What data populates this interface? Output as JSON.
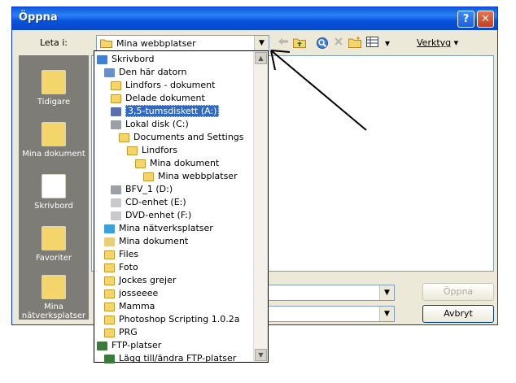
{
  "window": {
    "title": "Öppna",
    "help_label": "?",
    "close_label": "✕"
  },
  "lookin": {
    "label": "Leta i:",
    "value": "Mina webbplatser"
  },
  "toolbar": {
    "tools_label": "Verktyg"
  },
  "places": [
    {
      "label": "Tidigare",
      "icon": "recent-icon"
    },
    {
      "label": "Mina dokument",
      "icon": "my-documents-icon"
    },
    {
      "label": "Skrivbord",
      "icon": "desktop-icon"
    },
    {
      "label": "Favoriter",
      "icon": "favorites-icon"
    },
    {
      "label": "Mina nätverksplatser",
      "icon": "network-places-icon"
    }
  ],
  "buttons": {
    "open_label": "Öppna",
    "cancel_label": "Avbryt"
  },
  "dropdown": {
    "items": [
      {
        "label": "Skrivbord",
        "icon": "desktop-icon"
      },
      {
        "label": "Den här datorn",
        "icon": "computer-icon"
      },
      {
        "label": "Lindfors - dokument",
        "icon": "folder-icon"
      },
      {
        "label": "Delade dokument",
        "icon": "folder-icon"
      },
      {
        "label": "3,5-tumsdiskett (A:)",
        "icon": "floppy-icon",
        "selected": true
      },
      {
        "label": "Lokal disk (C:)",
        "icon": "drive-icon"
      },
      {
        "label": "Documents and Settings",
        "icon": "folder-icon"
      },
      {
        "label": "Lindfors",
        "icon": "folder-icon"
      },
      {
        "label": "Mina dokument",
        "icon": "folder-icon"
      },
      {
        "label": "Mina webbplatser",
        "icon": "folder-icon"
      },
      {
        "label": "BFV_1 (D:)",
        "icon": "drive-icon"
      },
      {
        "label": "CD-enhet (E:)",
        "icon": "cd-icon"
      },
      {
        "label": "DVD-enhet (F:)",
        "icon": "dvd-icon"
      },
      {
        "label": "Mina nätverksplatser",
        "icon": "network-icon"
      },
      {
        "label": "Mina dokument",
        "icon": "documents-icon"
      },
      {
        "label": "Files",
        "icon": "folder-icon"
      },
      {
        "label": "Foto",
        "icon": "folder-icon"
      },
      {
        "label": "Jockes grejer",
        "icon": "folder-icon"
      },
      {
        "label": "josseeee",
        "icon": "folder-icon"
      },
      {
        "label": "Mamma",
        "icon": "folder-icon"
      },
      {
        "label": "Photoshop Scripting 1.0.2a",
        "icon": "folder-icon"
      },
      {
        "label": "PRG",
        "icon": "folder-icon"
      },
      {
        "label": "FTP-platser",
        "icon": "ftp-icon"
      },
      {
        "label": "Lägg till/ändra FTP-platser",
        "icon": "ftp-icon"
      }
    ]
  },
  "colors": {
    "titlebar": "#0a5fd8",
    "selection": "#316ac5",
    "folder": "#f3d56b"
  }
}
